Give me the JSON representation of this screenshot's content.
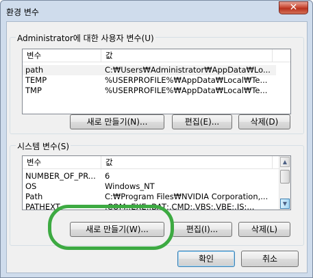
{
  "window": {
    "title": "환경 변수",
    "close_glyph": "✕"
  },
  "user_section": {
    "label": "Administrator에 대한 사용자 변수(U)",
    "headers": [
      "변수",
      "값"
    ],
    "rows": [
      {
        "name": "path",
        "value": "C:₩Users₩Administrator₩AppData₩Lo..."
      },
      {
        "name": "TEMP",
        "value": "%USERPROFILE%₩AppData₩Local₩Te..."
      },
      {
        "name": "TMP",
        "value": "%USERPROFILE%₩AppData₩Local₩Te..."
      }
    ],
    "buttons": {
      "new": "새로 만들기(N)...",
      "edit": "편집(E)...",
      "delete": "삭제(D)"
    }
  },
  "system_section": {
    "label": "시스템 변수(S)",
    "headers": [
      "변수",
      "값"
    ],
    "rows": [
      {
        "name": "NUMBER_OF_PR...",
        "value": "6"
      },
      {
        "name": "OS",
        "value": "Windows_NT"
      },
      {
        "name": "Path",
        "value": "C:₩Program Files₩NVIDIA Corporation,..."
      },
      {
        "name": "PATHEXT",
        "value": ".COM;.EXE;.BAT;.CMD;.VBS;.VBE;.JS;..."
      }
    ],
    "buttons": {
      "new": "새로 만들기(W)...",
      "edit": "편집(I)...",
      "delete": "삭제(L)"
    }
  },
  "dialog_buttons": {
    "ok": "확인",
    "cancel": "취소"
  },
  "colors": {
    "highlight_ring": "#3daa42",
    "close_button": "#c94a35",
    "default_button_border": "#3c7fb1"
  }
}
